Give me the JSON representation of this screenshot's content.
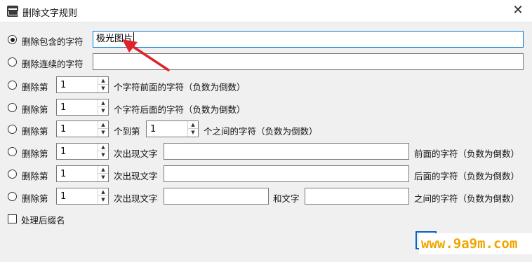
{
  "window": {
    "title": "删除文字规则"
  },
  "rows": {
    "r1": {
      "label": "删除包含的字符",
      "value": "极光图片",
      "checked": true
    },
    "r2": {
      "label": "删除连续的字符",
      "value": ""
    },
    "r3": {
      "label": "删除第",
      "spin": "1",
      "suffix": "个字符前面的字符（负数为倒数）"
    },
    "r4": {
      "label": "删除第",
      "spin": "1",
      "suffix": "个字符后面的字符（负数为倒数）"
    },
    "r5": {
      "label": "删除第",
      "spin1": "1",
      "mid": "个到第",
      "spin2": "1",
      "suffix": "个之间的字符（负数为倒数）"
    },
    "r6": {
      "label": "删除第",
      "spin": "1",
      "mid": "次出现文字",
      "text": "",
      "suffix": "前面的字符（负数为倒数）"
    },
    "r7": {
      "label": "删除第",
      "spin": "1",
      "mid": "次出现文字",
      "text": "",
      "suffix": "后面的字符（负数为倒数）"
    },
    "r8": {
      "label": "删除第",
      "spin": "1",
      "mid": "次出现文字",
      "text1": "",
      "mid2": "和文字",
      "text2": "",
      "suffix": "之间的字符（负数为倒数）"
    }
  },
  "options": {
    "suffix_label": "处理后缀名"
  },
  "watermark": {
    "text": "www.9a9m.com"
  },
  "colors": {
    "annotation_arrow": "#e0222a",
    "watermark": "#f0a500",
    "focus": "#0078d7"
  }
}
